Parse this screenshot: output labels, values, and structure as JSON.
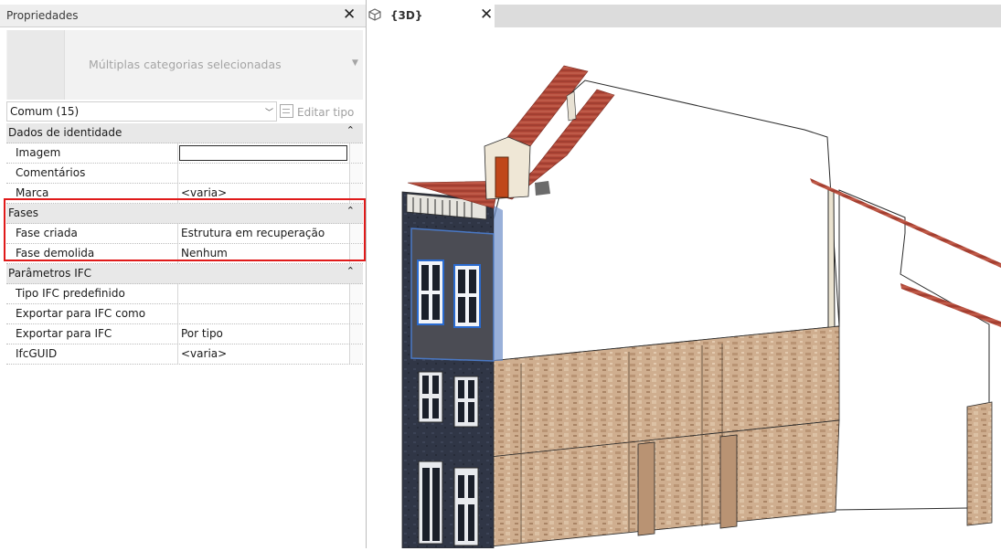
{
  "properties": {
    "title": "Propriedades",
    "type_selector": "Múltiplas categorias selecionadas",
    "instance_filter": "Comum (15)",
    "edit_type": "Editar tipo",
    "groups": [
      {
        "name": "Dados de identidade",
        "rows": [
          {
            "name": "Imagem",
            "value": ""
          },
          {
            "name": "Comentários",
            "value": ""
          },
          {
            "name": "Marca",
            "value": "<varia>"
          }
        ]
      },
      {
        "name": "Fases",
        "rows": [
          {
            "name": "Fase criada",
            "value": "Estrutura em recuperação"
          },
          {
            "name": "Fase demolida",
            "value": "Nenhum"
          }
        ]
      },
      {
        "name": "Parâmetros IFC",
        "rows": [
          {
            "name": "Tipo IFC predefinido",
            "value": ""
          },
          {
            "name": "Exportar para IFC como",
            "value": ""
          },
          {
            "name": "Exportar para IFC",
            "value": "Por tipo"
          },
          {
            "name": "IfcGUID",
            "value": "<varia>"
          }
        ]
      }
    ]
  },
  "view": {
    "tab_label": "{3D}"
  },
  "colors": {
    "highlight": "#e01a1a",
    "roof_tile": "#b84a3c",
    "stone": "#c9a789",
    "facade_dark": "#2f3646",
    "selection": "#4a78c4"
  }
}
